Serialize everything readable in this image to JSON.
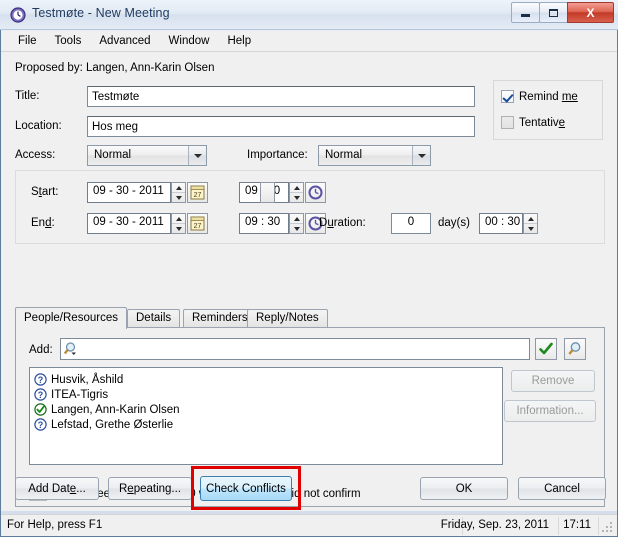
{
  "window": {
    "title": "Testmøte - New Meeting",
    "icon": "clock-icon",
    "minimize_label": "Minimize",
    "maximize_label": "Maximize",
    "close_label": "X"
  },
  "menubar": {
    "items": [
      {
        "label": "File"
      },
      {
        "label": "Tools"
      },
      {
        "label": "Advanced"
      },
      {
        "label": "Window"
      },
      {
        "label": "Help"
      }
    ]
  },
  "form": {
    "proposed_by": "Proposed by: Langen, Ann-Karin Olsen",
    "title_label": "Title:",
    "title_value": "Testmøte",
    "location_label": "Location:",
    "location_value": "Hos meg",
    "access_label": "Access:",
    "access_value": "Normal",
    "importance_label": "Importance:",
    "importance_value": "Normal",
    "access_options": [
      "Normal"
    ],
    "importance_options": [
      "Normal"
    ]
  },
  "options": {
    "remind_me": {
      "label_pre": "Remind ",
      "label_key": "me",
      "checked": true
    },
    "tentative": {
      "label_pre": "Tentativ",
      "label_key": "e",
      "checked": false
    }
  },
  "schedule": {
    "start_label_pre": "S",
    "start_label_key": "t",
    "start_label_post": "art:",
    "start_date": "09 - 30 - 2011",
    "start_time": "09 : 00",
    "end_label_pre": "En",
    "end_label_key": "d",
    "end_label_post": ":",
    "end_date": "09 - 30 - 2011",
    "end_time": "09 : 30",
    "duration_label_pre": "D",
    "duration_label_key": "u",
    "duration_label_post": "ration:",
    "duration_days": "0",
    "days_label": "day(s)",
    "duration_time": "00 : 30",
    "calendar_day": "27"
  },
  "tabs": [
    {
      "label": "People/Resources",
      "active": true
    },
    {
      "label": "Details",
      "active": false
    },
    {
      "label": "Reminders",
      "active": false
    },
    {
      "label": "Reply/Notes",
      "active": false
    }
  ],
  "people": {
    "add_label": "Add:",
    "add_value": "",
    "add_placeholder": "",
    "accept_button": "check-icon",
    "search_button": "magnifier-icon",
    "remove_button": "Remove",
    "information_button": "Information...",
    "attendees": [
      {
        "name": "Husvik, Åshild",
        "status": "unknown"
      },
      {
        "name": "ITEA-Tigris",
        "status": "unknown"
      },
      {
        "name": "Langen, Ann-Karin Olsen",
        "status": "accepted"
      },
      {
        "name": "Lefstad, Grethe Østerlie",
        "status": "unknown"
      }
    ],
    "summary": "4 Attendees; 1 will attend, 0 will not attend, 3 did not confirm"
  },
  "footer": {
    "add_date_pre": "Add Dat",
    "add_date_key": "e",
    "add_date_post": "...",
    "repeating_pre": "R",
    "repeating_key": "e",
    "repeating_post": "peating...",
    "check_conflicts": "Check Conflicts",
    "ok": "OK",
    "cancel": "Cancel"
  },
  "statusbar": {
    "help_text": "For Help, press F1",
    "date": "Friday, Sep. 23, 2011",
    "time": "17:11"
  },
  "colors": {
    "highlight_box": "#e10000",
    "accent_blue": "#3c7fb1",
    "status_ok_green": "#1a8a1a",
    "status_unknown_blue": "#2b4fa0"
  }
}
